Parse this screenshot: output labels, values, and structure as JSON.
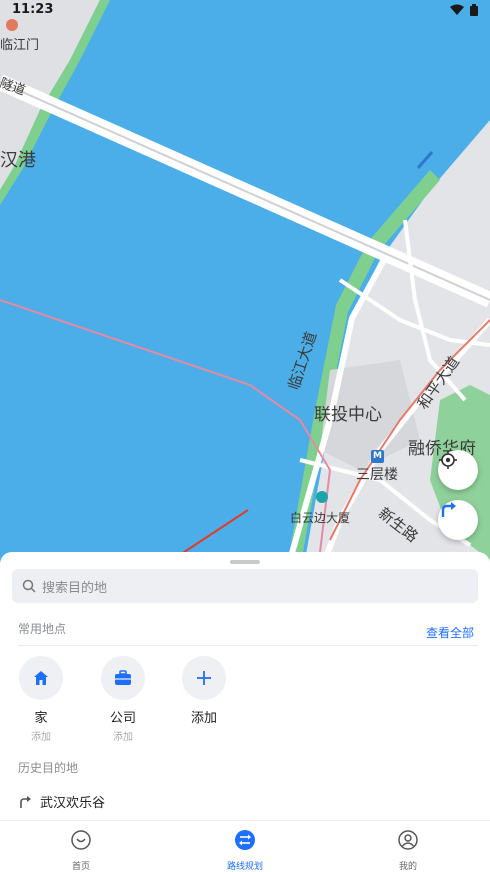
{
  "status_bar": {
    "time": "11:23"
  },
  "map": {
    "labels": {
      "linjiang_gate": "临江门",
      "tunnel": "隧道",
      "hanjiang_port": "汉港",
      "linjiang_avenue": "临江大道",
      "lianTou_center": "联投中心",
      "heping_avenue": "和平大道",
      "rongqiao_huafu": "融侨华府",
      "sancenglou": "三层楼",
      "baiyunbian_building": "白云边大厦",
      "xinsheng_road": "新生路"
    },
    "metro_badge": "M"
  },
  "search": {
    "placeholder": "搜索目的地"
  },
  "common_places": {
    "title": "常用地点",
    "view_all": "查看全部",
    "items": [
      {
        "label": "家",
        "sub": "添加",
        "icon": "home-icon"
      },
      {
        "label": "公司",
        "sub": "添加",
        "icon": "briefcase-icon"
      },
      {
        "label": "添加",
        "sub": "",
        "icon": "plus-icon"
      }
    ]
  },
  "history": {
    "title": "历史目的地",
    "items": [
      {
        "label": "武汉欢乐谷"
      }
    ]
  },
  "tabs": [
    {
      "label": "首页",
      "icon": "home-tab-icon",
      "active": false
    },
    {
      "label": "路线规划",
      "icon": "route-tab-icon",
      "active": true
    },
    {
      "label": "我的",
      "icon": "profile-tab-icon",
      "active": false
    }
  ],
  "colors": {
    "accent": "#1f6fff",
    "water": "#4baee8",
    "land": "#e3e4e8",
    "park": "#8fd19a"
  }
}
